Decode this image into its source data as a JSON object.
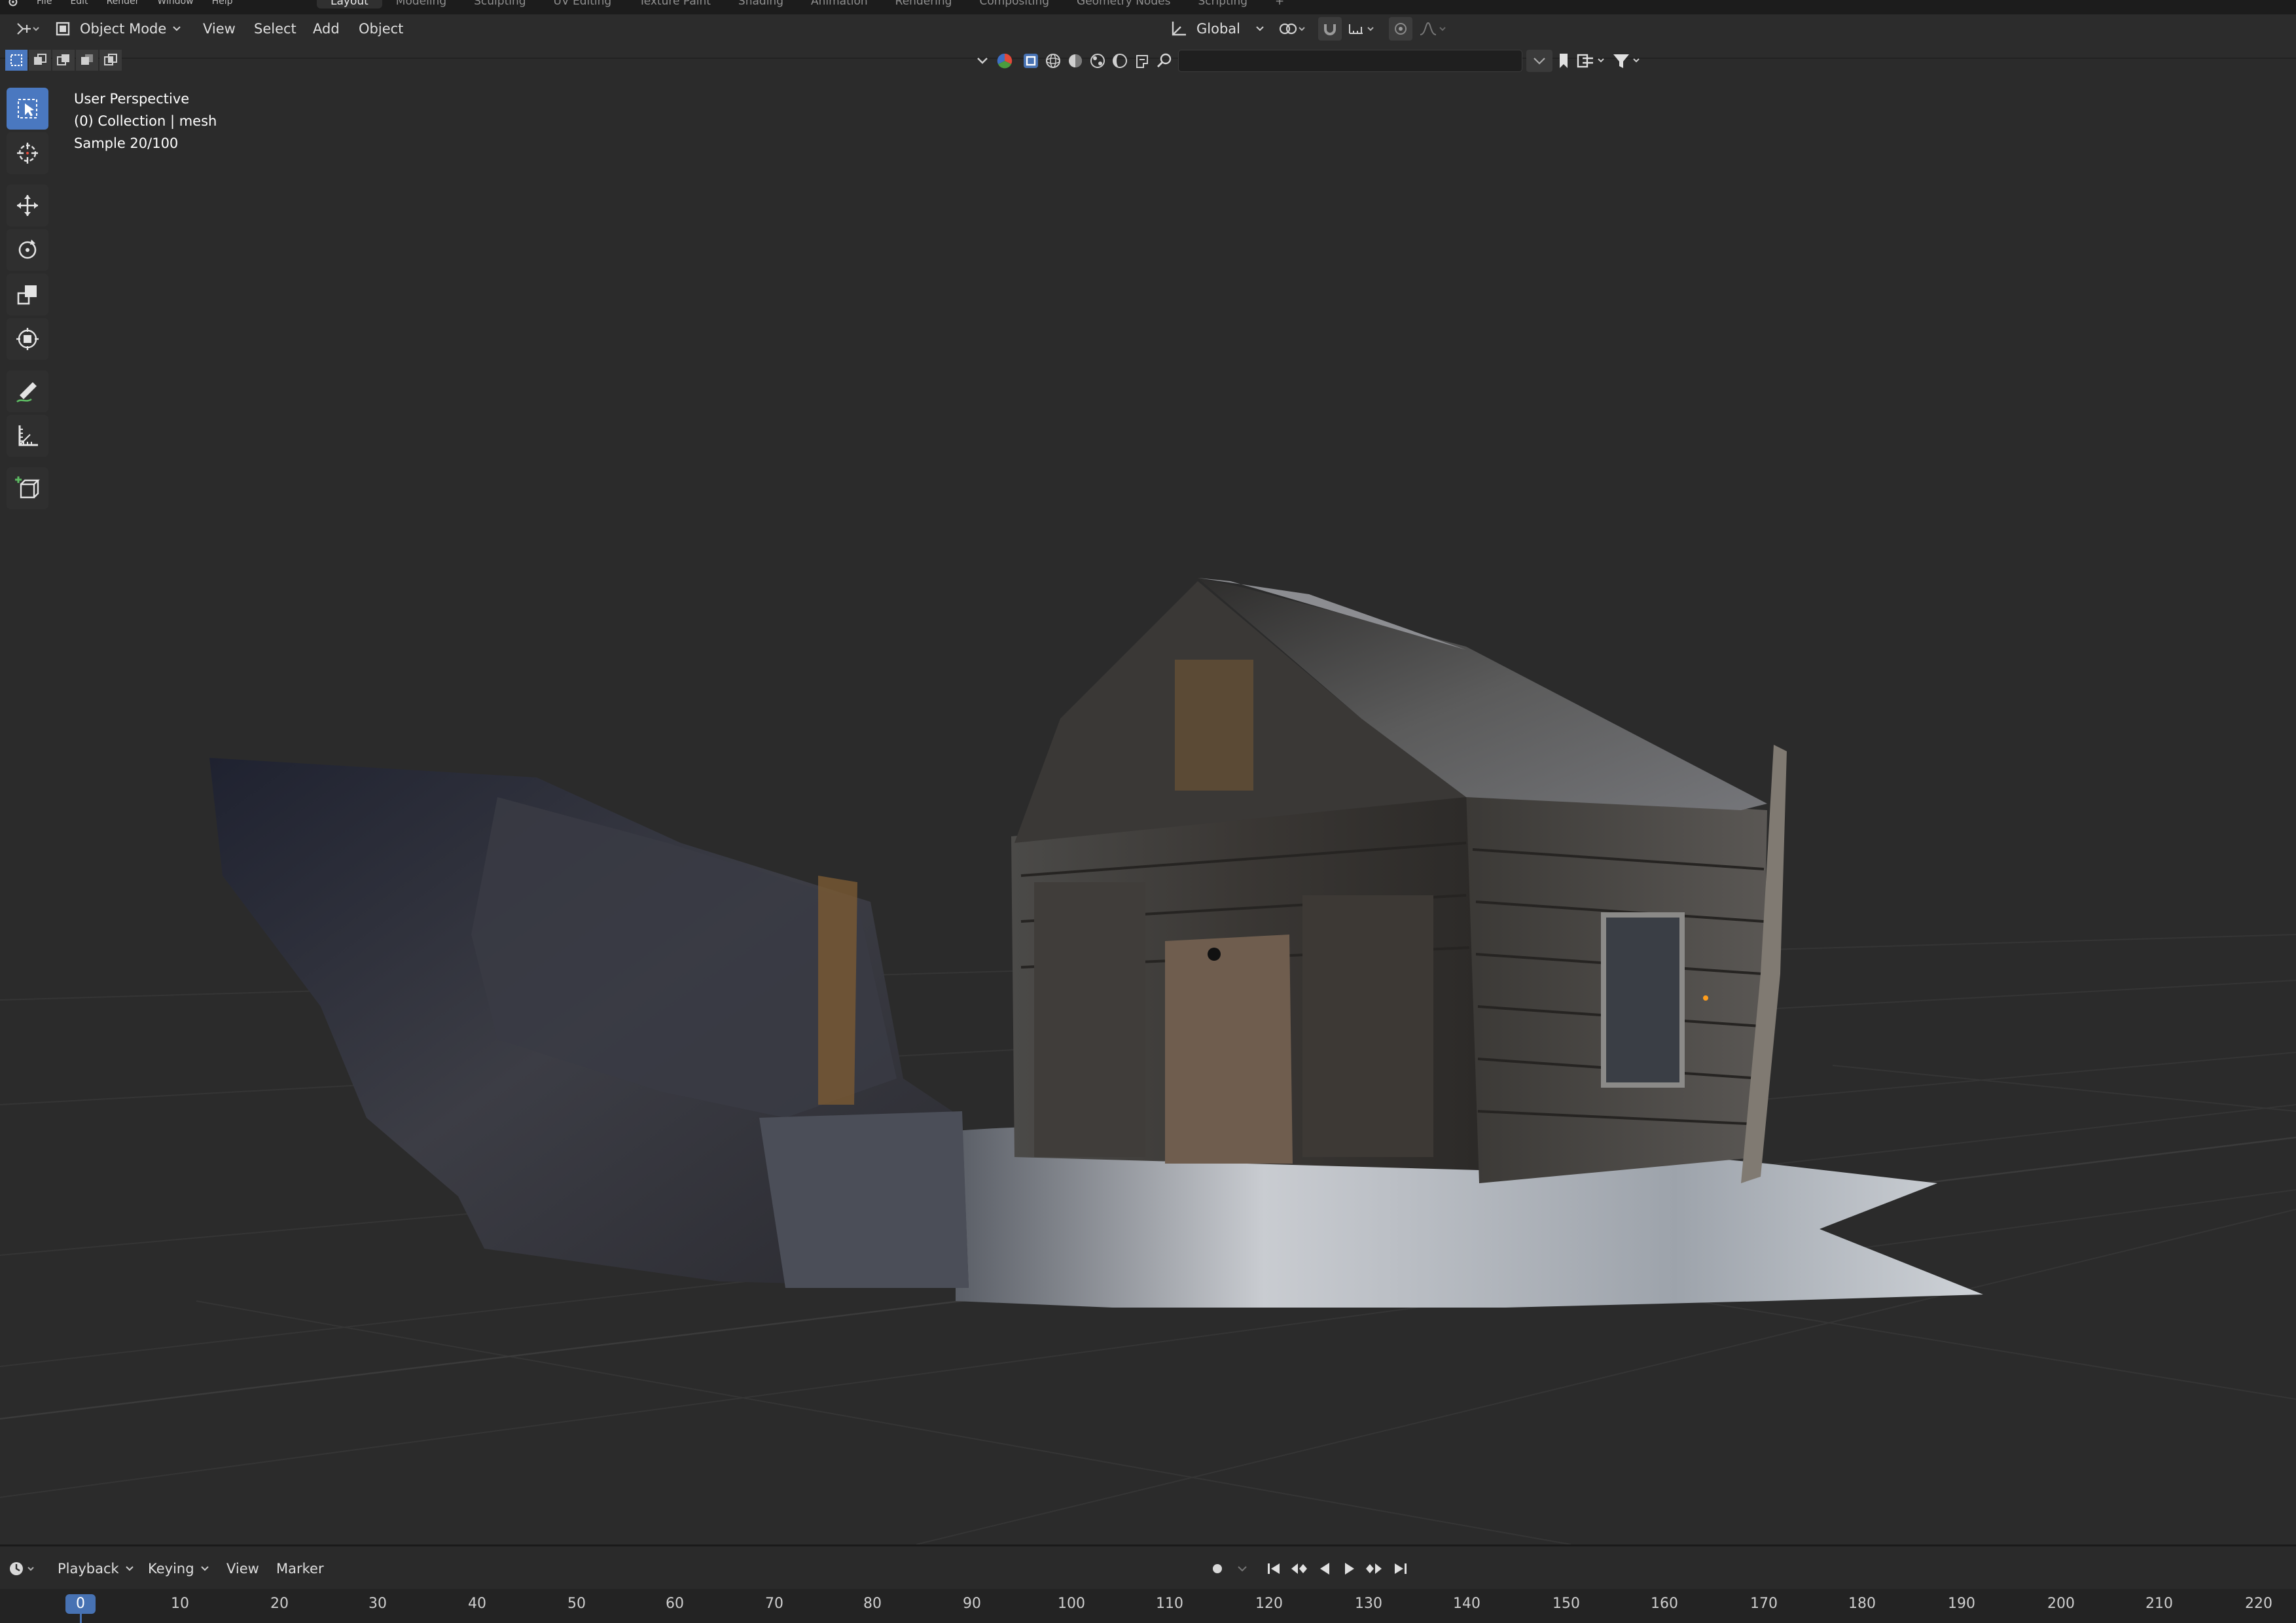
{
  "topbar": {
    "menus": [
      "File",
      "Edit",
      "Render",
      "Window",
      "Help"
    ],
    "workspaces": [
      "Layout",
      "Modeling",
      "Sculpting",
      "UV Editing",
      "Texture Paint",
      "Shading",
      "Animation",
      "Rendering",
      "Compositing",
      "Geometry Nodes",
      "Scripting"
    ],
    "active_workspace": "Layout",
    "add_label": "+"
  },
  "header": {
    "mode": "Object Mode",
    "menus": [
      "View",
      "Select",
      "Add",
      "Object"
    ],
    "transform_orientation": "Global",
    "search_placeholder": ""
  },
  "viewport": {
    "overlay": {
      "perspective": "User Perspective",
      "collection": "(0) Collection | mesh",
      "sample": "Sample 20/100"
    },
    "tools": [
      "select-box-icon",
      "cursor-icon",
      "move-icon",
      "rotate-icon",
      "scale-icon",
      "transform-icon",
      "annotate-icon",
      "measure-icon",
      "add-cube-icon"
    ],
    "active_tool": "select-box-icon"
  },
  "timeline": {
    "menus": [
      "Playback",
      "Keying",
      "View",
      "Marker"
    ],
    "current_frame": "0",
    "ticks": [
      "10",
      "20",
      "30",
      "40",
      "50",
      "60",
      "70",
      "80",
      "90",
      "100",
      "110",
      "120",
      "130",
      "140",
      "150",
      "160",
      "170",
      "180",
      "190",
      "200",
      "210",
      "220"
    ]
  },
  "colors": {
    "accent": "#4772b3",
    "background": "#2b2b2b",
    "header": "#2c2c2c"
  }
}
